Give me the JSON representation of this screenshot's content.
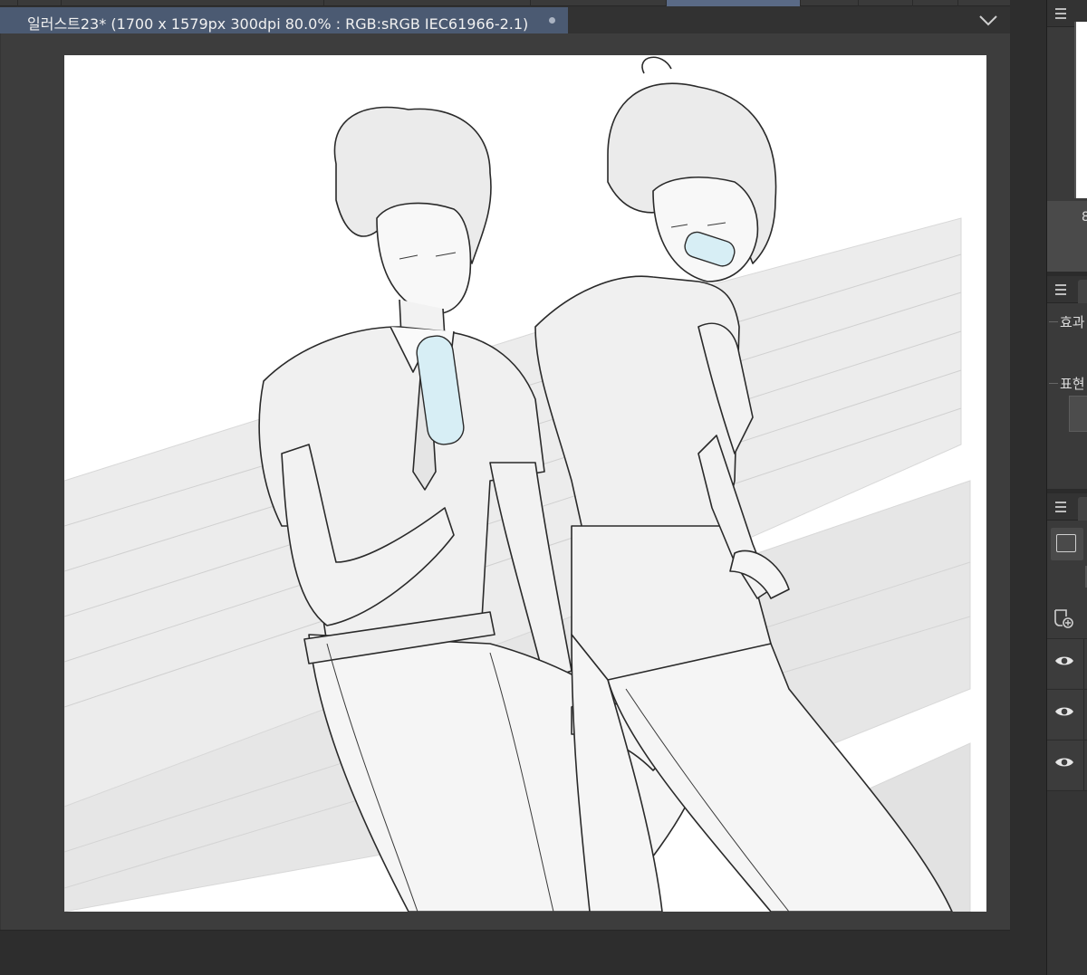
{
  "document_tab": {
    "title": "일러스트23* (1700 x 1579px 300dpi 80.0% : RGB:sRGB IEC61966-2.1)"
  },
  "right_panels": {
    "navigator_digit": "8",
    "effects_label": "효과",
    "expression_label": "표현"
  },
  "icons": {
    "tab_modified": "dot-icon",
    "tab_close": "close-dot-icon",
    "collapse": "chevron-down-icon",
    "panel_menu": "hamburger-menu-icon",
    "layer_visibility": "eye-icon",
    "new_layer": "new-layer-icon",
    "layer_tool": "rectangle-icon"
  },
  "colors": {
    "active_tab": "#4b5a72",
    "canvas_bg": "#ffffff",
    "workspace_bg": "#3d3d3d",
    "panel_bg": "#3a3a3a"
  },
  "canvas": {
    "artwork": "pencil sketch of two students in school uniforms sitting on a bench eating popsicles"
  }
}
